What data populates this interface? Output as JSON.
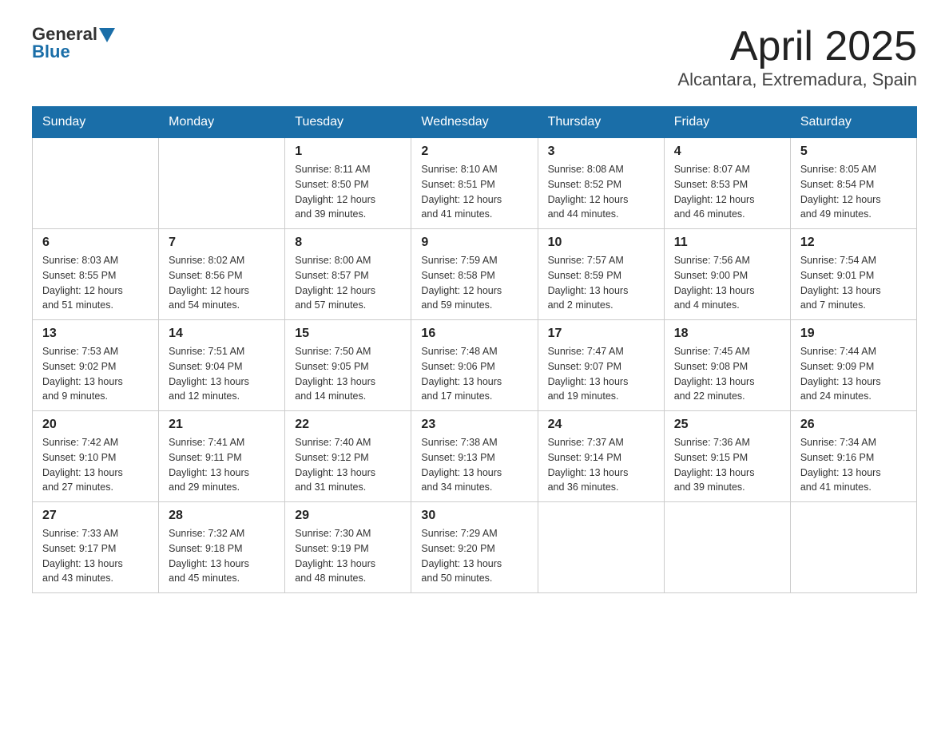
{
  "logo": {
    "general": "General",
    "blue": "Blue"
  },
  "title": "April 2025",
  "subtitle": "Alcantara, Extremadura, Spain",
  "weekdays": [
    "Sunday",
    "Monday",
    "Tuesday",
    "Wednesday",
    "Thursday",
    "Friday",
    "Saturday"
  ],
  "weeks": [
    [
      {
        "day": "",
        "info": ""
      },
      {
        "day": "",
        "info": ""
      },
      {
        "day": "1",
        "info": "Sunrise: 8:11 AM\nSunset: 8:50 PM\nDaylight: 12 hours\nand 39 minutes."
      },
      {
        "day": "2",
        "info": "Sunrise: 8:10 AM\nSunset: 8:51 PM\nDaylight: 12 hours\nand 41 minutes."
      },
      {
        "day": "3",
        "info": "Sunrise: 8:08 AM\nSunset: 8:52 PM\nDaylight: 12 hours\nand 44 minutes."
      },
      {
        "day": "4",
        "info": "Sunrise: 8:07 AM\nSunset: 8:53 PM\nDaylight: 12 hours\nand 46 minutes."
      },
      {
        "day": "5",
        "info": "Sunrise: 8:05 AM\nSunset: 8:54 PM\nDaylight: 12 hours\nand 49 minutes."
      }
    ],
    [
      {
        "day": "6",
        "info": "Sunrise: 8:03 AM\nSunset: 8:55 PM\nDaylight: 12 hours\nand 51 minutes."
      },
      {
        "day": "7",
        "info": "Sunrise: 8:02 AM\nSunset: 8:56 PM\nDaylight: 12 hours\nand 54 minutes."
      },
      {
        "day": "8",
        "info": "Sunrise: 8:00 AM\nSunset: 8:57 PM\nDaylight: 12 hours\nand 57 minutes."
      },
      {
        "day": "9",
        "info": "Sunrise: 7:59 AM\nSunset: 8:58 PM\nDaylight: 12 hours\nand 59 minutes."
      },
      {
        "day": "10",
        "info": "Sunrise: 7:57 AM\nSunset: 8:59 PM\nDaylight: 13 hours\nand 2 minutes."
      },
      {
        "day": "11",
        "info": "Sunrise: 7:56 AM\nSunset: 9:00 PM\nDaylight: 13 hours\nand 4 minutes."
      },
      {
        "day": "12",
        "info": "Sunrise: 7:54 AM\nSunset: 9:01 PM\nDaylight: 13 hours\nand 7 minutes."
      }
    ],
    [
      {
        "day": "13",
        "info": "Sunrise: 7:53 AM\nSunset: 9:02 PM\nDaylight: 13 hours\nand 9 minutes."
      },
      {
        "day": "14",
        "info": "Sunrise: 7:51 AM\nSunset: 9:04 PM\nDaylight: 13 hours\nand 12 minutes."
      },
      {
        "day": "15",
        "info": "Sunrise: 7:50 AM\nSunset: 9:05 PM\nDaylight: 13 hours\nand 14 minutes."
      },
      {
        "day": "16",
        "info": "Sunrise: 7:48 AM\nSunset: 9:06 PM\nDaylight: 13 hours\nand 17 minutes."
      },
      {
        "day": "17",
        "info": "Sunrise: 7:47 AM\nSunset: 9:07 PM\nDaylight: 13 hours\nand 19 minutes."
      },
      {
        "day": "18",
        "info": "Sunrise: 7:45 AM\nSunset: 9:08 PM\nDaylight: 13 hours\nand 22 minutes."
      },
      {
        "day": "19",
        "info": "Sunrise: 7:44 AM\nSunset: 9:09 PM\nDaylight: 13 hours\nand 24 minutes."
      }
    ],
    [
      {
        "day": "20",
        "info": "Sunrise: 7:42 AM\nSunset: 9:10 PM\nDaylight: 13 hours\nand 27 minutes."
      },
      {
        "day": "21",
        "info": "Sunrise: 7:41 AM\nSunset: 9:11 PM\nDaylight: 13 hours\nand 29 minutes."
      },
      {
        "day": "22",
        "info": "Sunrise: 7:40 AM\nSunset: 9:12 PM\nDaylight: 13 hours\nand 31 minutes."
      },
      {
        "day": "23",
        "info": "Sunrise: 7:38 AM\nSunset: 9:13 PM\nDaylight: 13 hours\nand 34 minutes."
      },
      {
        "day": "24",
        "info": "Sunrise: 7:37 AM\nSunset: 9:14 PM\nDaylight: 13 hours\nand 36 minutes."
      },
      {
        "day": "25",
        "info": "Sunrise: 7:36 AM\nSunset: 9:15 PM\nDaylight: 13 hours\nand 39 minutes."
      },
      {
        "day": "26",
        "info": "Sunrise: 7:34 AM\nSunset: 9:16 PM\nDaylight: 13 hours\nand 41 minutes."
      }
    ],
    [
      {
        "day": "27",
        "info": "Sunrise: 7:33 AM\nSunset: 9:17 PM\nDaylight: 13 hours\nand 43 minutes."
      },
      {
        "day": "28",
        "info": "Sunrise: 7:32 AM\nSunset: 9:18 PM\nDaylight: 13 hours\nand 45 minutes."
      },
      {
        "day": "29",
        "info": "Sunrise: 7:30 AM\nSunset: 9:19 PM\nDaylight: 13 hours\nand 48 minutes."
      },
      {
        "day": "30",
        "info": "Sunrise: 7:29 AM\nSunset: 9:20 PM\nDaylight: 13 hours\nand 50 minutes."
      },
      {
        "day": "",
        "info": ""
      },
      {
        "day": "",
        "info": ""
      },
      {
        "day": "",
        "info": ""
      }
    ]
  ]
}
